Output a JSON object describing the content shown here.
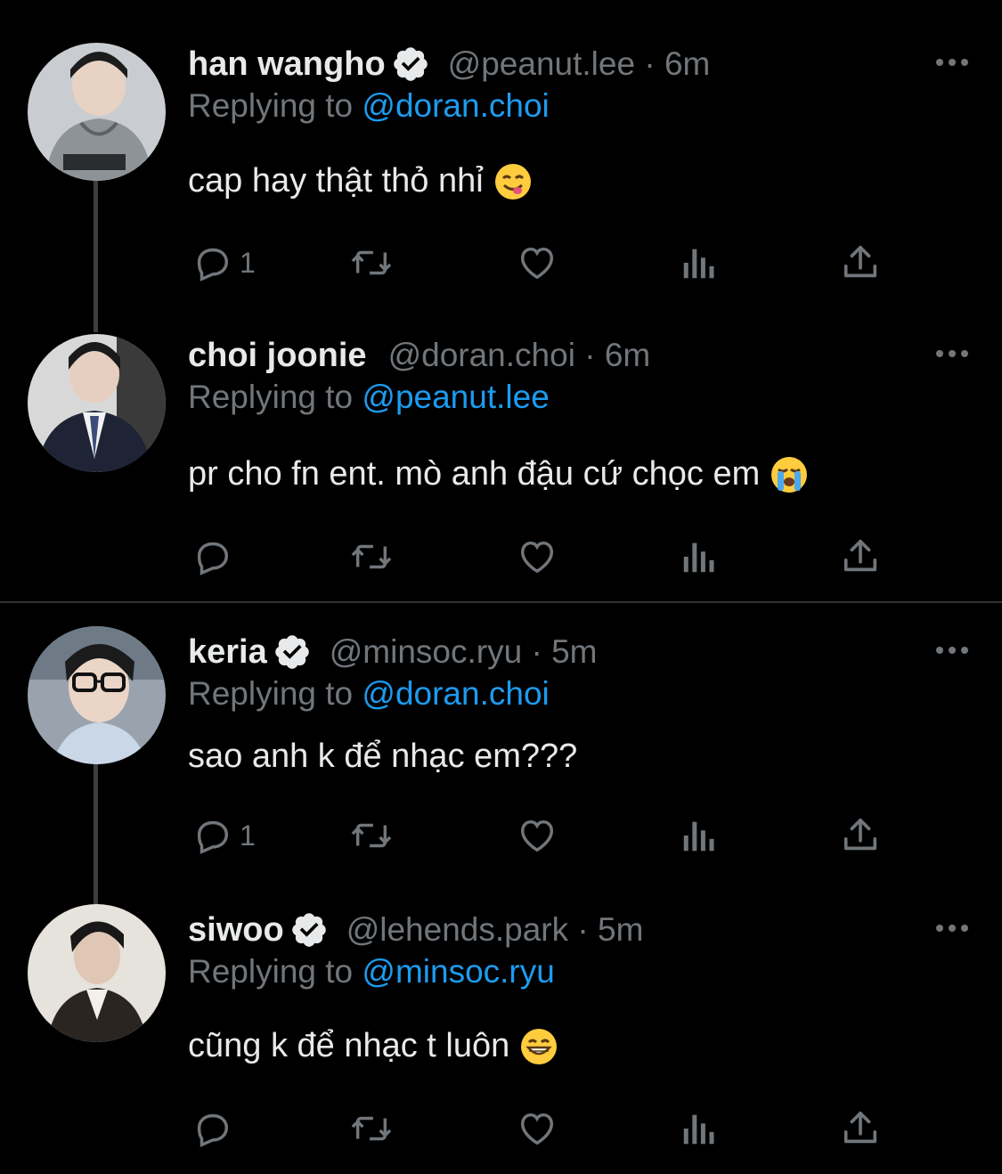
{
  "tweets": [
    {
      "name": "han wangho",
      "verified": true,
      "handle": "@peanut.lee",
      "time": "6m",
      "replying_prefix": "Replying to ",
      "replying_to": "@doran.choi",
      "text": "cap hay thật thỏ nhỉ",
      "emoji": "face-savoring-food",
      "reply_count": "1"
    },
    {
      "name": "choi joonie",
      "verified": false,
      "handle": "@doran.choi",
      "time": "6m",
      "replying_prefix": "Replying to ",
      "replying_to": "@peanut.lee",
      "text": "pr cho fn ent. mò anh đậu cứ chọc em",
      "emoji": "loudly-crying-face",
      "reply_count": ""
    },
    {
      "name": "keria",
      "verified": true,
      "handle": "@minsoc.ryu",
      "time": "5m",
      "replying_prefix": "Replying to ",
      "replying_to": "@doran.choi",
      "text": "sao anh k để nhạc em???",
      "emoji": "",
      "reply_count": "1"
    },
    {
      "name": "siwoo",
      "verified": true,
      "handle": "@lehends.park",
      "time": "5m",
      "replying_prefix": "Replying to ",
      "replying_to": "@minsoc.ryu",
      "text": "cũng k để nhạc t luôn",
      "emoji": "grinning-face-with-smiling-eyes",
      "reply_count": ""
    }
  ],
  "separator": " · ",
  "icons": {
    "reply": "reply-icon",
    "retweet": "retweet-icon",
    "like": "heart-icon",
    "views": "views-icon",
    "share": "share-icon",
    "more": "more-icon",
    "verified": "verified-badge-icon"
  },
  "colors": {
    "background": "#000000",
    "text": "#e7e9ea",
    "muted": "#71767b",
    "link": "#1d9bf0",
    "thread_line": "#3a3f44"
  }
}
